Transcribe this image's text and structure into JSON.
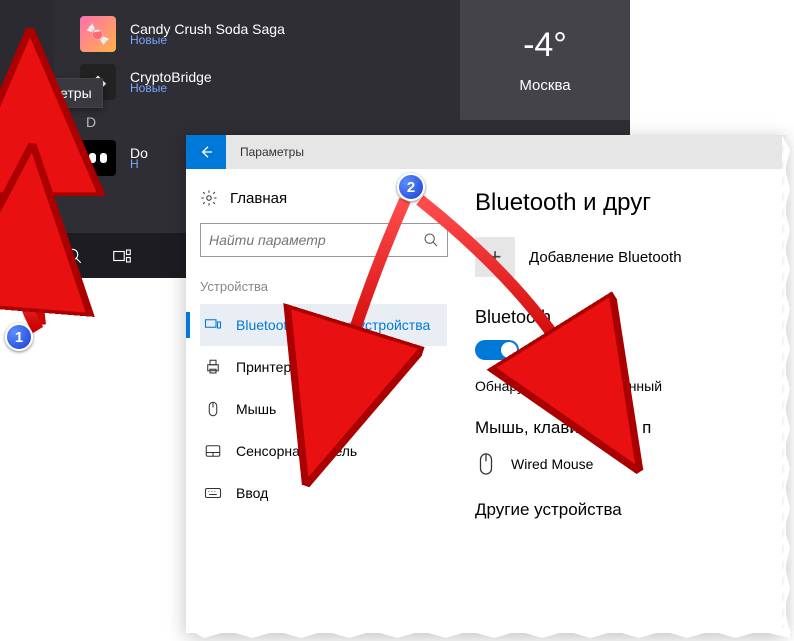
{
  "tooltip": "Параметры",
  "apps": {
    "candy": {
      "name": "Candy Crush Soda Saga",
      "sub": "Новые"
    },
    "crypto": {
      "name": "CryptoBridge",
      "sub": "Новые"
    },
    "letter_d": "D",
    "dolby_initial": "Do",
    "dolby_sub_initial": "Н"
  },
  "weather": {
    "temp": "-4°",
    "city": "Москва"
  },
  "settings": {
    "title": "Параметры",
    "home": "Главная",
    "search_placeholder": "Найти параметр",
    "group": "Устройства",
    "items": {
      "bluetooth": "Bluetooth и другие устройства",
      "printers": "Принтеры и сканеры",
      "mouse": "Мышь",
      "touchpad": "Сенсорная панель",
      "input": "Ввод"
    }
  },
  "content": {
    "heading": "Bluetooth и друг",
    "add_label": "Добавление Bluetooth",
    "bt_section": "Bluetooth",
    "toggle_state": "Вкл.",
    "discoverable": "Обнаруживаемое на данный",
    "mouse_kbd": "Мышь, клавиатура и п",
    "wired_mouse": "Wired Mouse",
    "other": "Другие устройства"
  },
  "badges": {
    "one": "1",
    "two": "2"
  }
}
